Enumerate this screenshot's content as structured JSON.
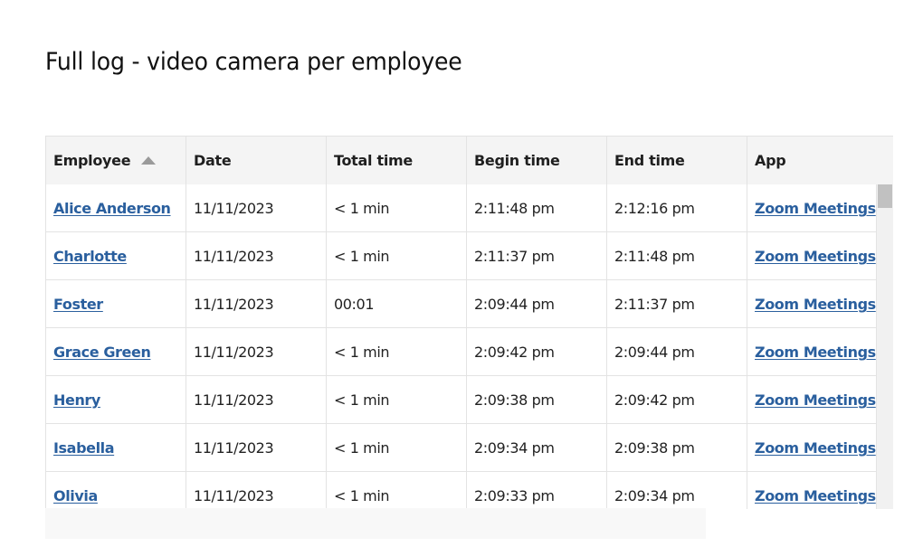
{
  "page": {
    "title": "Full log - video camera per employee"
  },
  "table": {
    "columns": [
      "Employee",
      "Date",
      "Total time",
      "Begin time",
      "End time",
      "App"
    ],
    "sort_column": "Employee",
    "sort_direction": "ascending",
    "rows": [
      {
        "employee": "Alice Anderson",
        "date": "11/11/2023",
        "total": "< 1 min",
        "begin": "2:11:48 pm",
        "end": "2:12:16 pm",
        "app": "Zoom Meetings"
      },
      {
        "employee": "Charlotte",
        "date": "11/11/2023",
        "total": "< 1 min",
        "begin": "2:11:37 pm",
        "end": "2:11:48 pm",
        "app": "Zoom Meetings"
      },
      {
        "employee": "Foster",
        "date": "11/11/2023",
        "total": "00:01",
        "begin": "2:09:44 pm",
        "end": "2:11:37 pm",
        "app": "Zoom Meetings"
      },
      {
        "employee": "Grace Green",
        "date": "11/11/2023",
        "total": "< 1 min",
        "begin": "2:09:42 pm",
        "end": "2:09:44 pm",
        "app": "Zoom Meetings"
      },
      {
        "employee": "Henry",
        "date": "11/11/2023",
        "total": "< 1 min",
        "begin": "2:09:38 pm",
        "end": "2:09:42 pm",
        "app": "Zoom Meetings"
      },
      {
        "employee": "Isabella",
        "date": "11/11/2023",
        "total": "< 1 min",
        "begin": "2:09:34 pm",
        "end": "2:09:38 pm",
        "app": "Zoom Meetings"
      },
      {
        "employee": "Olivia",
        "date": "11/11/2023",
        "total": "< 1 min",
        "begin": "2:09:33 pm",
        "end": "2:09:34 pm",
        "app": "Zoom Meetings"
      }
    ]
  },
  "colors": {
    "link": "#2a5f9e",
    "header_bg": "#f4f4f4",
    "border": "#e3e3e3",
    "sort_arrow": "#9a9a9a"
  },
  "icons": {
    "sort": "sort-ascending-icon"
  }
}
